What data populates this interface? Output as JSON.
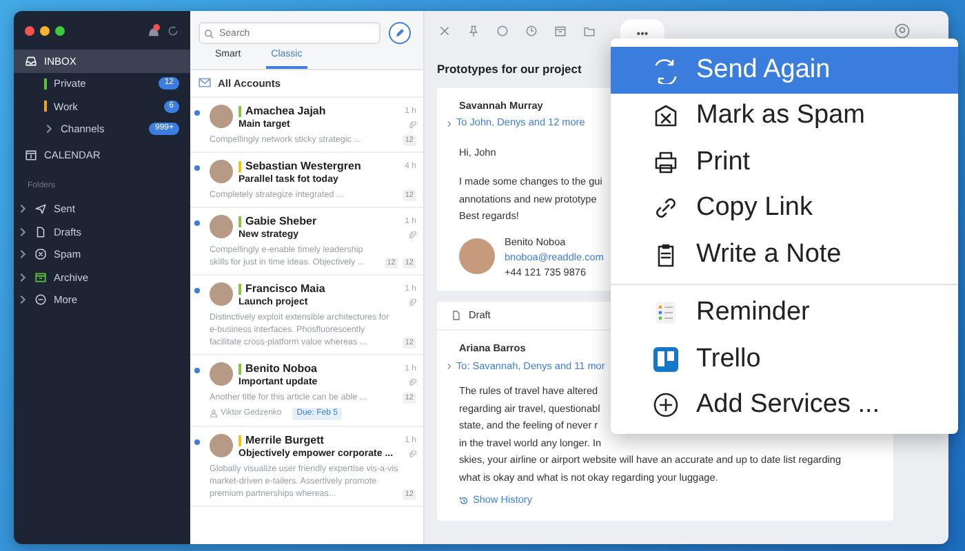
{
  "sidebar": {
    "mailboxes": [
      {
        "label": "INBOX",
        "kind": "inbox",
        "selected": true,
        "children": [
          {
            "label": "Private",
            "color": "#5cc33a",
            "badge": "12"
          },
          {
            "label": "Work",
            "color": "#e8a628",
            "badge": "6"
          },
          {
            "label": "Channels",
            "badge": "999+",
            "expanded": false
          }
        ]
      },
      {
        "label": "CALENDAR",
        "kind": "calendar",
        "selected": false
      }
    ],
    "folders_heading": "Folders",
    "folders": [
      {
        "label": "Sent",
        "kind": "sent",
        "expanded": false
      },
      {
        "label": "Drafts",
        "kind": "drafts",
        "expanded": false
      },
      {
        "label": "Spam",
        "kind": "spam",
        "expanded": false
      },
      {
        "label": "Archive",
        "kind": "archive",
        "expanded": false
      },
      {
        "label": "More",
        "kind": "more",
        "expanded": false
      }
    ]
  },
  "message_list": {
    "search": {
      "placeholder": "Search"
    },
    "tabs": [
      {
        "label": "Smart",
        "selected": false
      },
      {
        "label": "Classic",
        "selected": true
      }
    ],
    "account": "All Accounts",
    "messages": [
      {
        "sender": "Amachea Jajah",
        "color": "#8cc63f",
        "time": "1 h",
        "subject": "Main target",
        "attachment": true,
        "unread": true,
        "preview": "Compellingly network sticky strategic ...",
        "counts": [
          "12"
        ]
      },
      {
        "sender": "Sebastian Westergren",
        "color": "#f0c419",
        "time": "4 h",
        "subject": "Parallel task fot today",
        "attachment": false,
        "unread": true,
        "preview": "Completely strategize integrated ...",
        "counts": [
          "12"
        ]
      },
      {
        "sender": "Gabie Sheber",
        "color": "#8cc63f",
        "time": "1 h",
        "subject": "New strategy",
        "attachment": true,
        "unread": true,
        "preview": "Compellingly e-enable timely leadership skills for just in time ideas. Objectively ...",
        "counts": [
          "12",
          "12"
        ]
      },
      {
        "sender": "Francisco Maia",
        "color": "#8cc63f",
        "time": "1 h",
        "subject": "Launch project",
        "attachment": true,
        "unread": true,
        "preview": "Distinctively exploit extensible architectures for e-business interfaces. Phosfluorescently facilitate cross-platform value whereas ...",
        "counts": [
          "12"
        ]
      },
      {
        "sender": "Benito Noboa",
        "color": "#8cc63f",
        "time": "1 h",
        "subject": "Important update",
        "attachment": true,
        "unread": true,
        "preview": "Another title for this article can be able ...",
        "counts": [
          "12"
        ],
        "assignee": "Viktor Gedzenko",
        "due": "Due: Feb 5"
      },
      {
        "sender": "Merrile Burgett",
        "color": "#f0c419",
        "time": "1 h",
        "subject": "Objectively empower corporate ...",
        "attachment": true,
        "unread": true,
        "preview": "Globally visualize user friendly expertise vis-a-vis market-driven e-tailers. Assertively promote premium partnerships whereas...",
        "counts": [
          "12"
        ]
      }
    ]
  },
  "reader": {
    "more_button": "•••",
    "subject": "Prototypes for our project",
    "message": {
      "sender": "Savannah Murray",
      "to": "To John, Denys and 12 more",
      "greeting": "Hi, John",
      "lines": [
        "I made some changes to the gui",
        "annotations and new prototype",
        "Best regards!"
      ],
      "signature": {
        "name": "Benito Noboa",
        "email": "bnoboa@readdle.com",
        "phone": "+44 121 735 9876"
      }
    },
    "draft": {
      "label": "Draft",
      "sender": "Ariana Barros",
      "to": "To: Savannah, Denys and 11 mor",
      "lines": [
        "The rules of travel have altered",
        "regarding air travel, questionabl",
        "state, and the feeling of never r",
        "in the travel world any longer. In",
        "skies, your airline or airport website will have an accurate and up to date list regarding",
        "what is okay and what is not okay regarding your luggage."
      ],
      "history": "Show History"
    }
  },
  "menu": {
    "groups": [
      [
        {
          "label": "Send Again",
          "kind": "refresh",
          "selected": true
        },
        {
          "label": "Mark as Spam",
          "kind": "spam",
          "selected": false
        },
        {
          "label": "Print",
          "kind": "print",
          "selected": false
        },
        {
          "label": "Copy Link",
          "kind": "link",
          "selected": false
        },
        {
          "label": "Write a Note",
          "kind": "note",
          "selected": false
        }
      ],
      [
        {
          "label": "Reminder",
          "kind": "reminder",
          "selected": false
        },
        {
          "label": "Trello",
          "kind": "trello",
          "selected": false
        },
        {
          "label": "Add Services ...",
          "kind": "add",
          "selected": false
        }
      ]
    ]
  }
}
